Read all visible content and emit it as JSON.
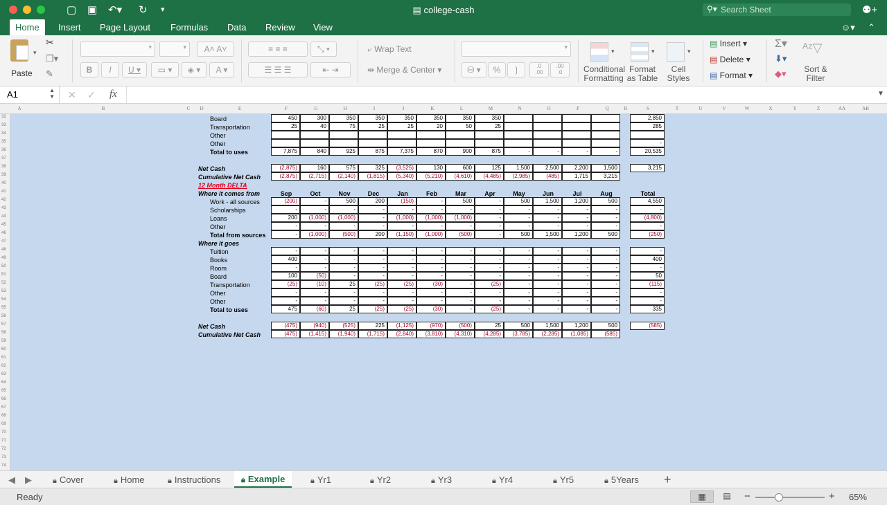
{
  "window": {
    "title": "college-cash",
    "search_placeholder": "Search Sheet"
  },
  "ribbon_tabs": [
    "Home",
    "Insert",
    "Page Layout",
    "Formulas",
    "Data",
    "Review",
    "View"
  ],
  "ribbon": {
    "paste": "Paste",
    "wrap_text": "Wrap Text",
    "merge_center": "Merge & Center",
    "percent": "%",
    "dec_increase": ".00\n→.0",
    "conditional_formatting": [
      "Conditional",
      "Formatting"
    ],
    "format_as_table": [
      "Format",
      "as Table"
    ],
    "cell_styles": [
      "Cell",
      "Styles"
    ],
    "insert": "Insert",
    "delete": "Delete",
    "format": "Format",
    "sort_filter": [
      "Sort &",
      "Filter"
    ]
  },
  "formula_bar": {
    "name_box": "A1",
    "fx": "fx",
    "content": ""
  },
  "columns": [
    "A",
    "B",
    "C",
    "D",
    "E",
    "F",
    "G",
    "H",
    "I",
    "J",
    "K",
    "L",
    "M",
    "N",
    "O",
    "P",
    "Q",
    "R",
    "S",
    "T",
    "U",
    "V",
    "W",
    "X",
    "Y",
    "Z",
    "AA",
    "AB"
  ],
  "row_numbers": [
    "32",
    "33",
    "34",
    "35",
    "36",
    "37",
    "38",
    "39",
    "40",
    "41",
    "42",
    "43",
    "44",
    "45",
    "46",
    "47",
    "48",
    "49",
    "50",
    "51",
    "52",
    "53",
    "54",
    "55",
    "56",
    "57",
    "58",
    "59",
    "60",
    "61",
    "62",
    "63",
    "64",
    "65",
    "66",
    "67",
    "68",
    "69",
    "70",
    "71",
    "72",
    "73",
    "74"
  ],
  "sheet": {
    "delta_title": "12 Month DELTA",
    "month_headers": [
      "Sep",
      "Oct",
      "Nov",
      "Dec",
      "Jan",
      "Feb",
      "Mar",
      "Apr",
      "May",
      "Jun",
      "Jul",
      "Aug"
    ],
    "total_header": "Total",
    "rows": [
      {
        "r": 0,
        "label": "Board",
        "style": "indent",
        "vals": [
          "450",
          "300",
          "350",
          "350",
          "350",
          "350",
          "350",
          "350",
          "",
          "",
          "",
          ""
        ],
        "total": "2,850"
      },
      {
        "r": 1,
        "label": "Transportation",
        "style": "indent",
        "vals": [
          "25",
          "40",
          "75",
          "25",
          "25",
          "20",
          "50",
          "25",
          "",
          "",
          "",
          ""
        ],
        "total": "285"
      },
      {
        "r": 2,
        "label": "Other",
        "style": "indent",
        "vals": [
          "",
          "",
          "",
          "",
          "",
          "",
          "",
          "",
          "",
          "",
          "",
          ""
        ],
        "total": ""
      },
      {
        "r": 3,
        "label": "Other",
        "style": "indent",
        "vals": [
          "",
          "",
          "",
          "",
          "",
          "",
          "",
          "",
          "",
          "",
          "",
          ""
        ],
        "total": "-"
      },
      {
        "r": 4,
        "label": "Total to uses",
        "style": "bold",
        "vals": [
          "7,875",
          "840",
          "925",
          "875",
          "7,375",
          "870",
          "900",
          "875",
          "-",
          "-",
          "-",
          "-"
        ],
        "total": "20,535"
      },
      {
        "r": 6,
        "label": "Net Cash",
        "style": "bi",
        "vals": [
          "(2,875)",
          "160",
          "575",
          "325",
          "(3,525)",
          "130",
          "600",
          "125",
          "1,500",
          "2,500",
          "2,200",
          "1,500"
        ],
        "total": "3,215"
      },
      {
        "r": 7,
        "label": "Cumulative Net Cash",
        "style": "bi",
        "vals": [
          "(2,875)",
          "(2,715)",
          "(2,140)",
          "(1,815)",
          "(5,340)",
          "(5,210)",
          "(4,610)",
          "(4,485)",
          "(2,985)",
          "(485)",
          "1,715",
          "3,215"
        ],
        "total": null
      },
      {
        "r": 8,
        "label": "12 Month DELTA",
        "style": "red",
        "vals": null,
        "total": null
      },
      {
        "r": 9,
        "label": "Where it comes from",
        "style": "bi",
        "vals": null,
        "total": null,
        "headers": true
      },
      {
        "r": 10,
        "label": "Work - all sources",
        "style": "indent",
        "vals": [
          "(200)",
          "-",
          "500",
          "200",
          "(150)",
          "-",
          "500",
          "-",
          "500",
          "1,500",
          "1,200",
          "500"
        ],
        "total": "4,550"
      },
      {
        "r": 11,
        "label": "Scholarships",
        "style": "indent",
        "vals": [
          "-",
          "-",
          "-",
          "-",
          "-",
          "-",
          "-",
          "-",
          "-",
          "-",
          "-",
          "-"
        ],
        "total": "-"
      },
      {
        "r": 12,
        "label": "Loans",
        "style": "indent",
        "vals": [
          "200",
          "(1,000)",
          "(1,000)",
          "-",
          "(1,000)",
          "(1,000)",
          "(1,000)",
          "-",
          "-",
          "-",
          "-",
          "-"
        ],
        "total": "(4,800)"
      },
      {
        "r": 13,
        "label": "Other",
        "style": "indent",
        "vals": [
          "-",
          "-",
          "-",
          "-",
          "-",
          "-",
          "-",
          "-",
          "-",
          "-",
          "-",
          "-"
        ],
        "total": "-"
      },
      {
        "r": 14,
        "label": "Total from sources",
        "style": "bold",
        "vals": [
          "-",
          "(1,000)",
          "(500)",
          "200",
          "(1,150)",
          "(1,000)",
          "(500)",
          "-",
          "500",
          "1,500",
          "1,200",
          "500"
        ],
        "total": "(250)"
      },
      {
        "r": 15,
        "label": "Where it goes",
        "style": "bi",
        "vals": null,
        "total": null
      },
      {
        "r": 16,
        "label": "Tuition",
        "style": "indent",
        "vals": [
          "-",
          "-",
          "-",
          "-",
          "-",
          "-",
          "-",
          "-",
          "-",
          "-",
          "-",
          "-"
        ],
        "total": "-"
      },
      {
        "r": 17,
        "label": "Books",
        "style": "indent",
        "vals": [
          "400",
          "-",
          "-",
          "-",
          "-",
          "-",
          "-",
          "-",
          "-",
          "-",
          "-",
          "-"
        ],
        "total": "400"
      },
      {
        "r": 18,
        "label": "Room",
        "style": "indent",
        "vals": [
          "-",
          "-",
          "-",
          "-",
          "-",
          "-",
          "-",
          "-",
          "-",
          "-",
          "-",
          "-"
        ],
        "total": "-"
      },
      {
        "r": 19,
        "label": "Board",
        "style": "indent",
        "vals": [
          "100",
          "(50)",
          "-",
          "-",
          "-",
          "-",
          "-",
          "-",
          "-",
          "-",
          "-",
          "-"
        ],
        "total": "50"
      },
      {
        "r": 20,
        "label": "Transportation",
        "style": "indent",
        "vals": [
          "(25)",
          "(10)",
          "25",
          "(25)",
          "(25)",
          "(30)",
          "-",
          "(25)",
          "-",
          "-",
          "-",
          "-"
        ],
        "total": "(115)"
      },
      {
        "r": 21,
        "label": "Other",
        "style": "indent",
        "vals": [
          "-",
          "-",
          "-",
          "-",
          "-",
          "-",
          "-",
          "-",
          "-",
          "-",
          "-",
          "-"
        ],
        "total": "-"
      },
      {
        "r": 22,
        "label": "Other",
        "style": "indent",
        "vals": [
          "-",
          "-",
          "-",
          "-",
          "-",
          "-",
          "-",
          "-",
          "-",
          "-",
          "-",
          "-"
        ],
        "total": "-"
      },
      {
        "r": 23,
        "label": "Total to uses",
        "style": "bold",
        "vals": [
          "475",
          "(60)",
          "25",
          "(25)",
          "(25)",
          "(30)",
          "-",
          "(25)",
          "-",
          "-",
          "-",
          "-"
        ],
        "total": "335"
      },
      {
        "r": 25,
        "label": "Net Cash",
        "style": "bi",
        "vals": [
          "(475)",
          "(940)",
          "(525)",
          "225",
          "(1,125)",
          "(970)",
          "(500)",
          "25",
          "500",
          "1,500",
          "1,200",
          "500"
        ],
        "total": "(585)"
      },
      {
        "r": 26,
        "label": "Cumulative Net Cash",
        "style": "bi",
        "vals": [
          "(475)",
          "(1,415)",
          "(1,940)",
          "(1,715)",
          "(2,840)",
          "(3,810)",
          "(4,310)",
          "(4,285)",
          "(3,785)",
          "(2,285)",
          "(1,085)",
          "(585)"
        ],
        "total": null
      }
    ]
  },
  "sheet_tabs": [
    "Cover",
    "Home",
    "Instructions",
    "Example",
    "Yr1",
    "Yr2",
    "Yr3",
    "Yr4",
    "Yr5",
    "5Years"
  ],
  "active_sheet": "Example",
  "status": {
    "ready": "Ready",
    "zoom": "65%"
  },
  "colors": {
    "excel_green": "#1e7145",
    "grid_bg": "#c6d8ee",
    "negative": "#a00026",
    "delta_red": "#e2001a"
  }
}
